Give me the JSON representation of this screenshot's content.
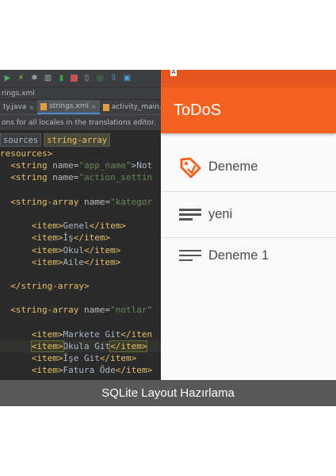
{
  "ide": {
    "path_label": "rings.xml",
    "tabs": [
      {
        "label": "ty.java",
        "close": "×"
      },
      {
        "label": "strings.xml",
        "close": "×"
      },
      {
        "label": "activity_main.:",
        "close": ""
      }
    ],
    "banner": "ons for all locales in the translations editor.",
    "breadcrumbs": [
      "sources",
      "string-array"
    ],
    "code": {
      "l1": "resources>",
      "l2_tag": "<string",
      "l2_attr": "name=",
      "l2_val": "\"app_name\"",
      "l2_rest": ">Not",
      "l3_tag": "<string",
      "l3_attr": "name=",
      "l3_val": "\"action_settin",
      "l4_tag": "<string-array",
      "l4_attr": "name=",
      "l4_val": "\"kategor",
      "items1": [
        "Genel",
        "İş",
        "Okul",
        "Aile"
      ],
      "close_array": "</string-array>",
      "l6_tag": "<string-array",
      "l6_attr": "name=",
      "l6_val": "\"notlar\"",
      "items2": [
        "Markete Git",
        "Okula Git",
        "İşe Git",
        "Fatura Öde"
      ],
      "item_open": "<item>",
      "item_close": "</item>",
      "item_close_cut": "</iten"
    }
  },
  "android": {
    "status_glyph": "A",
    "app_title": "ToDoS",
    "list_items": [
      {
        "label": "Deneme",
        "icon": "tag-icon"
      },
      {
        "label": "yeni",
        "icon": "menu-lines-icon"
      },
      {
        "label": "Deneme 1",
        "icon": "menu-lines-icon"
      }
    ]
  },
  "caption": "SQLite Layout Hazırlama",
  "colors": {
    "accent": "#f4621f",
    "statusbar": "#e8561f",
    "ide_bg": "#2b2b2b",
    "caption_bg": "#595959"
  }
}
